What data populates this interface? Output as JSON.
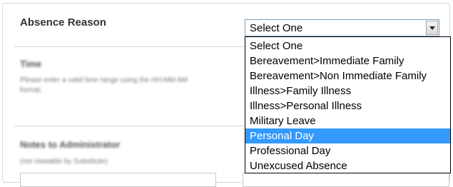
{
  "form": {
    "absence_reason_label": "Absence Reason",
    "time_label": "Time",
    "time_help": "Please enter a valid time range using the HH:MM AM format.",
    "notes_label": "Notes to Administrator",
    "notes_help": "(not viewable by Substitute)"
  },
  "select": {
    "value": "Select One",
    "arrow_icon": "chevron-down-icon",
    "options": [
      "Select One",
      "Bereavement>Immediate Family",
      "Bereavement>Non Immediate Family",
      "Illness>Family Illness",
      "Illness>Personal Illness",
      "Military Leave",
      "Personal Day",
      "Professional Day",
      "Unexcused Absence"
    ],
    "highlighted_option": "Personal Day",
    "highlight_color": "#3399ff"
  }
}
